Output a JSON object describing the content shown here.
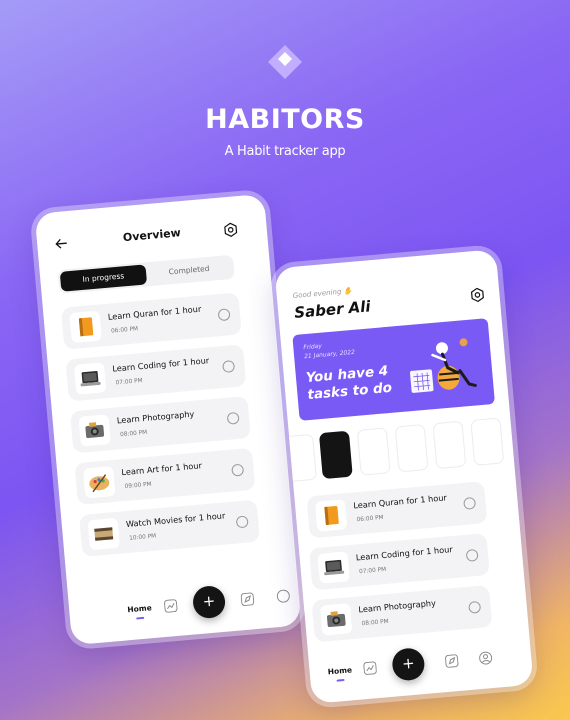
{
  "brand": {
    "title": "HABITORS",
    "subtitle": "A Habit tracker app",
    "accent": "#7b5cf3"
  },
  "overview": {
    "title": "Overview",
    "tabs": [
      {
        "label": "In progress",
        "active": true
      },
      {
        "label": "Completed",
        "active": false
      }
    ],
    "tasks": [
      {
        "name": "Learn Quran for 1 hour",
        "time": "06:00 PM",
        "icon": "book-icon"
      },
      {
        "name": "Learn Coding for 1 hour",
        "time": "07:00 PM",
        "icon": "laptop-icon"
      },
      {
        "name": "Learn Photography",
        "time": "08:00 PM",
        "icon": "camera-icon"
      },
      {
        "name": "Learn Art for 1 hour",
        "time": "09:00 PM",
        "icon": "palette-icon"
      },
      {
        "name": "Watch Movies for 1 hour",
        "time": "10:00 PM",
        "icon": "film-icon"
      }
    ],
    "nav": {
      "home": "Home",
      "fab": "+"
    }
  },
  "home": {
    "greeting": "Good evening ✋",
    "user": "Saber Ali",
    "banner": {
      "day": "Friday",
      "date": "21 January, 2022",
      "message": "You have 4 tasks to do"
    },
    "tasks": [
      {
        "name": "Learn Quran for 1 hour",
        "time": "06:00 PM",
        "icon": "book-icon"
      },
      {
        "name": "Learn Coding for 1 hour",
        "time": "07:00 PM",
        "icon": "laptop-icon"
      },
      {
        "name": "Learn Photography",
        "time": "08:00 PM",
        "icon": "camera-icon"
      }
    ],
    "nav": {
      "home": "Home",
      "fab": "+"
    }
  }
}
